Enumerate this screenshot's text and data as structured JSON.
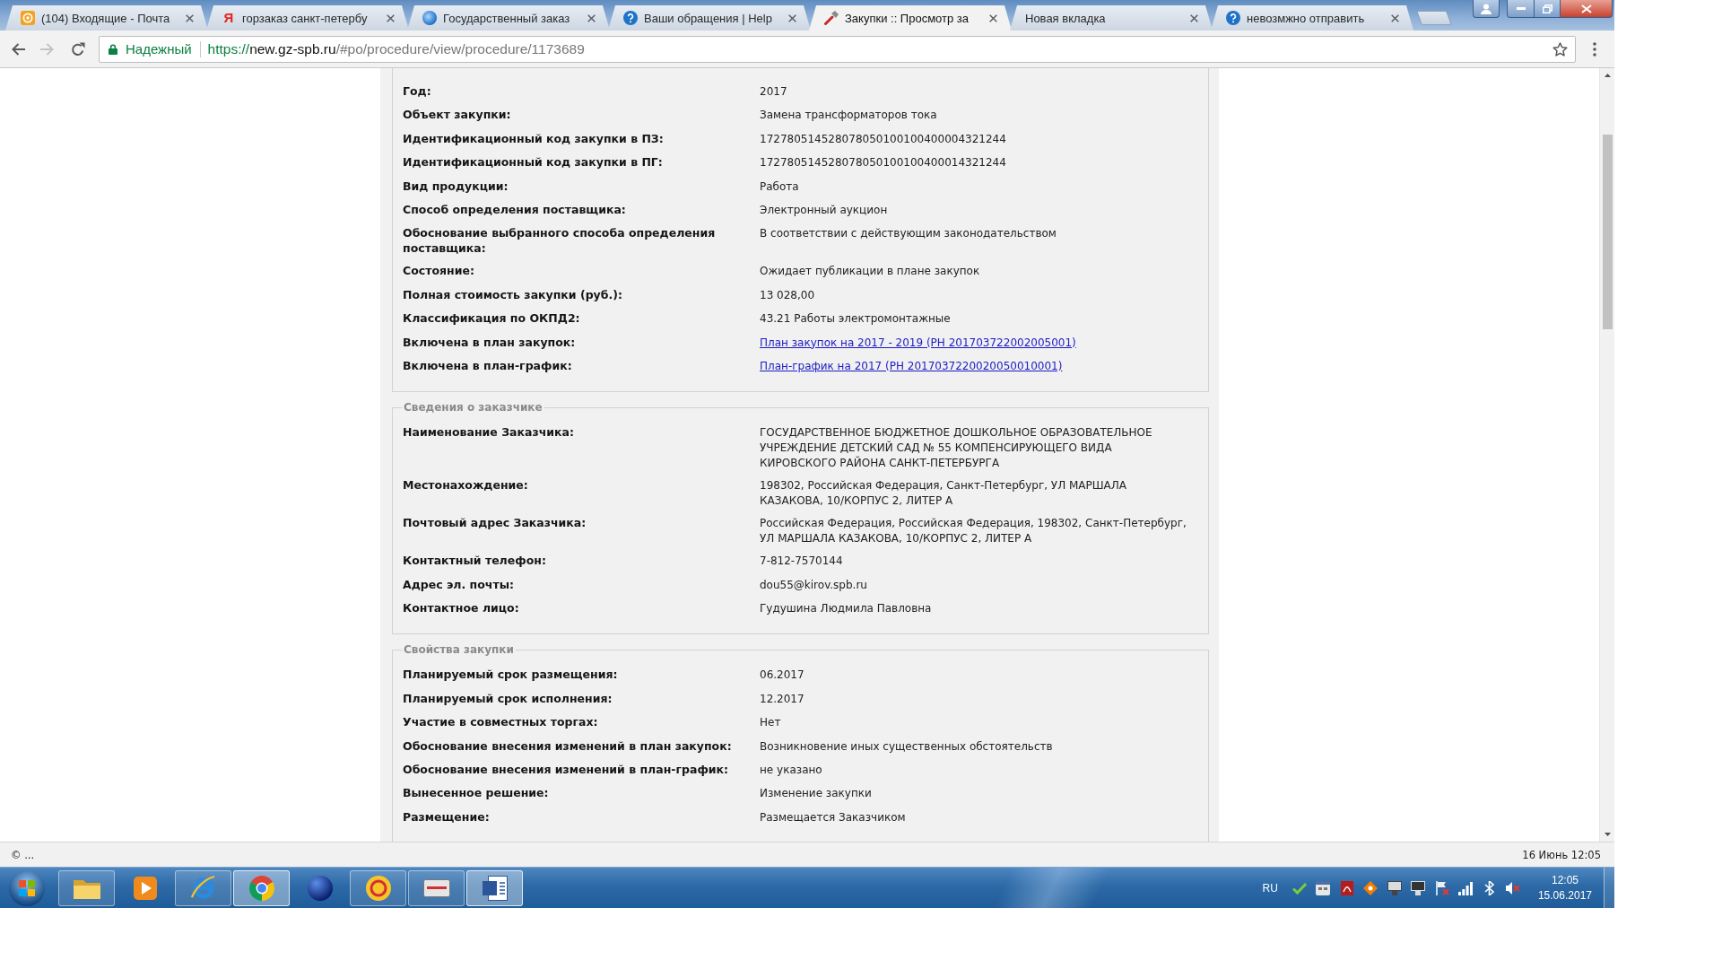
{
  "tabs": [
    {
      "title": "(104) Входящие - Почта",
      "favicon": {
        "kind": "mail"
      },
      "selected": false
    },
    {
      "title": "горзаказ санкт-петербу",
      "favicon": {
        "kind": "letter",
        "text": "Я"
      },
      "selected": false
    },
    {
      "title": "Государственный заказ",
      "favicon": {
        "kind": "globe"
      },
      "selected": false
    },
    {
      "title": "Ваши обращения | Help",
      "favicon": {
        "kind": "help"
      },
      "selected": false
    },
    {
      "title": "Закупки :: Просмотр за",
      "favicon": {
        "kind": "tools"
      },
      "selected": true
    },
    {
      "title": "Новая вкладка",
      "selected": false
    },
    {
      "title": "невозмжно отправить",
      "favicon": {
        "kind": "help"
      },
      "selected": false
    }
  ],
  "toolbar": {
    "nav_buttons": [
      {
        "kind": "back",
        "disabled": false
      },
      {
        "kind": "forward",
        "disabled": true
      },
      {
        "kind": "reload",
        "disabled": false
      }
    ],
    "address": {
      "security_label": "Надежный",
      "url": {
        "scheme": "https://",
        "host": "new.gz-spb.ru",
        "path": "/#po/procedure/view/procedure/1173689"
      }
    }
  },
  "page": {
    "sections": [
      {
        "rows": [
          {
            "label": "Год:",
            "value": "2017",
            "kind": "text"
          },
          {
            "label": "Объект закупки:",
            "value": "Замена трансформаторов тока",
            "kind": "text"
          },
          {
            "label": "Идентификационный код закупки в ПЗ:",
            "value": "172780514528078050100100400004321244",
            "kind": "text"
          },
          {
            "label": "Идентификационный код закупки в ПГ:",
            "value": "172780514528078050100100400014321244",
            "kind": "text"
          },
          {
            "label": "Вид продукции:",
            "value": "Работа",
            "kind": "text"
          },
          {
            "label": "Способ определения поставщика:",
            "value": "Электронный аукцион",
            "kind": "text"
          },
          {
            "label": "Обоснование выбранного способа определения поставщика:",
            "value": "В соответствии с действующим законодательством",
            "kind": "text"
          },
          {
            "label": "Состояние:",
            "value": "Ожидает публикации в плане закупок",
            "kind": "text"
          },
          {
            "label": "Полная стоимость закупки (руб.):",
            "value": "13 028,00",
            "kind": "text"
          },
          {
            "label": "Классификация по ОКПД2:",
            "value": "43.21 Работы электромонтажные",
            "kind": "text"
          },
          {
            "label": "Включена в план закупок:",
            "value": "План закупок на 2017 - 2019 (РН 201703722002005001)",
            "kind": "link"
          },
          {
            "label": "Включена в план-график:",
            "value": "План-график на 2017 (РН 2017037220020050010001)",
            "kind": "link"
          }
        ]
      },
      {
        "legend": "Сведения о заказчике",
        "rows": [
          {
            "label": "Наименование Заказчика:",
            "value": "ГОСУДАРСТВЕННОЕ БЮДЖЕТНОЕ ДОШКОЛЬНОЕ ОБРАЗОВАТЕЛЬНОЕ УЧРЕЖДЕНИЕ ДЕТСКИЙ САД № 55 КОМПЕНСИРУЮЩЕГО ВИДА КИРОВСКОГО РАЙОНА САНКТ-ПЕТЕРБУРГА",
            "kind": "text"
          },
          {
            "label": "Местонахождение:",
            "value": "198302, Российская Федерация, Санкт-Петербург, УЛ МАРШАЛА КАЗАКОВА, 10/КОРПУС 2, ЛИТЕР А",
            "kind": "text"
          },
          {
            "label": "Почтовый адрес Заказчика:",
            "value": "Российская Федерация, Российская Федерация, 198302, Санкт-Петербург, УЛ МАРШАЛА КАЗАКОВА, 10/КОРПУС 2, ЛИТЕР А",
            "kind": "text"
          },
          {
            "label": "Контактный телефон:",
            "value": "7-812-7570144",
            "kind": "text"
          },
          {
            "label": "Адрес эл. почты:",
            "value": "dou55@kirov.spb.ru",
            "kind": "text"
          },
          {
            "label": "Контактное лицо:",
            "value": "Гудушина Людмила Павловна",
            "kind": "text"
          }
        ]
      },
      {
        "legend": "Свойства закупки",
        "rows": [
          {
            "label": "Планируемый срок размещения:",
            "value": "06.2017",
            "kind": "text"
          },
          {
            "label": "Планируемый срок исполнения:",
            "value": "12.2017",
            "kind": "text"
          },
          {
            "label": "Участие в совместных торгах:",
            "value": "Нет",
            "kind": "text"
          },
          {
            "label": "Обоснование внесения изменений в план закупок:",
            "value": "Возникновение иных существенных обстоятельств",
            "kind": "text"
          },
          {
            "label": "Обоснование внесения изменений в план-график:",
            "value": "не указано",
            "kind": "text"
          },
          {
            "label": "Вынесенное решение:",
            "value": "Изменение закупки",
            "kind": "text"
          },
          {
            "label": "Размещение:",
            "value": "Размещается Заказчиком",
            "kind": "text"
          }
        ]
      }
    ]
  },
  "status_bar": {
    "left": "© ...",
    "right": "16 Июнь 12:05"
  },
  "taskbar": {
    "apps": [
      {
        "kind": "explorer",
        "running": true,
        "active": false
      },
      {
        "kind": "media",
        "running": false,
        "active": false
      },
      {
        "kind": "browser_e",
        "running": true,
        "active": false
      },
      {
        "kind": "browser_wheel",
        "running": true,
        "active": true
      },
      {
        "kind": "sphere",
        "running": false,
        "active": false
      },
      {
        "kind": "coin",
        "running": true,
        "active": false
      },
      {
        "kind": "device",
        "running": true,
        "active": false
      },
      {
        "kind": "document",
        "running": true,
        "active": true
      }
    ],
    "language": "RU",
    "time": "12:05",
    "date": "15.06.2017"
  }
}
